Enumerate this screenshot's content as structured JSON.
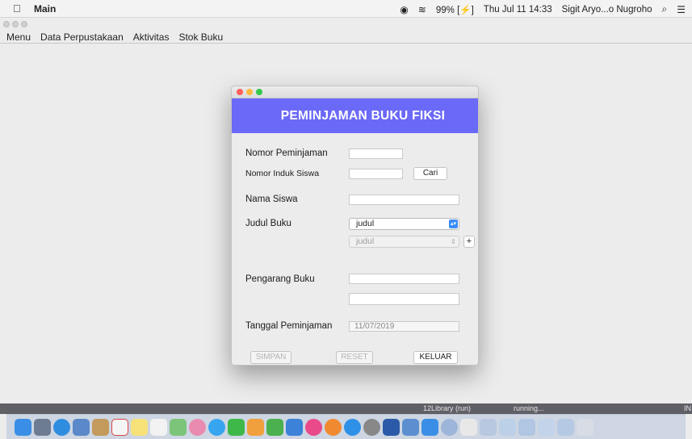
{
  "menubar": {
    "app_name": "Main",
    "battery": "99%",
    "datetime": "Thu Jul 11 14:33",
    "user": "Sigit Aryo...o Nugroho"
  },
  "app_menu": [
    "Menu",
    "Data Perpustakaan",
    "Aktivitas",
    "Stok Buku"
  ],
  "dialog": {
    "title": "PEMINJAMAN BUKU FIKSI",
    "labels": {
      "nomor_peminjaman": "Nomor Peminjaman",
      "nomor_induk": "Nomor Induk Siswa",
      "nama_siswa": "Nama Siswa",
      "judul_buku": "Judul Buku",
      "pengarang": "Pengarang Buku",
      "tanggal": "Tanggal Peminjaman"
    },
    "cari_label": "Cari",
    "judul_select": "judul",
    "judul_select2": "judul",
    "add_label": "+",
    "tanggal_value": "11/07/2019",
    "buttons": {
      "simpan": "SIMPAN",
      "reset": "RESET",
      "keluar": "KELUAR"
    }
  },
  "ide_strip": {
    "project": "12Library (run)",
    "status": "running...",
    "right": "IN"
  },
  "dock_icons": [
    "finder",
    "launchpad",
    "safari",
    "preview",
    "contacts",
    "calendar",
    "notes",
    "reminders",
    "maps",
    "photos",
    "messages",
    "facetime",
    "pages",
    "numbers",
    "keynote",
    "itunes",
    "books",
    "app-store",
    "system-preferences",
    "word",
    "remote-desktop",
    "finder-2",
    "utility",
    "java",
    "folder",
    "folder-2",
    "folder-3",
    "folder-4",
    "folder-5",
    "trash"
  ],
  "colors": {
    "header": "#6b69f7",
    "accent": "#3b8df7"
  }
}
